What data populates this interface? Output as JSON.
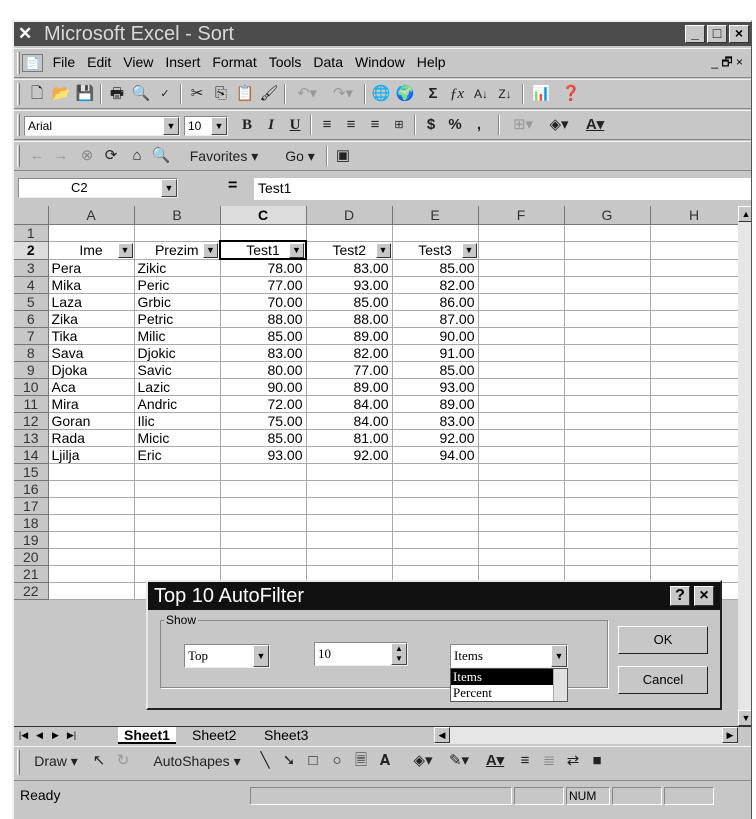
{
  "window": {
    "title": "Microsoft Excel - Sort",
    "min_label": "_",
    "max_label": "□",
    "close_label": "×"
  },
  "menu": {
    "items": [
      "File",
      "Edit",
      "View",
      "Insert",
      "Format",
      "Tools",
      "Data",
      "Window",
      "Help"
    ],
    "doc_controls": "_ 🗗 ×"
  },
  "toolbar_std": {
    "icons": [
      "new-icon",
      "open-icon",
      "save-icon",
      "print-icon",
      "print-preview-icon",
      "spelling-icon",
      "cut-icon",
      "copy-icon",
      "paste-icon",
      "format-painter-icon",
      "undo-icon",
      "redo-icon",
      "hyperlink-icon",
      "web-toolbar-icon",
      "autosum-icon",
      "paste-function-icon",
      "sort-ascending-icon",
      "sort-descending-icon",
      "chart-wizard-icon",
      "help-icon"
    ]
  },
  "toolbar_fmt": {
    "font": "Arial",
    "size": "10",
    "bold": "B",
    "italic": "I",
    "underline": "U",
    "currency": "$",
    "percent": "%",
    "comma": ","
  },
  "web_toolbar": {
    "favorites": "Favorites",
    "go": "Go"
  },
  "formula_bar": {
    "name_box": "C2",
    "equals": "=",
    "formula": "Test1"
  },
  "columns": [
    "A",
    "B",
    "C",
    "D",
    "E",
    "F",
    "G",
    "H"
  ],
  "rows": [
    {
      "n": "1",
      "cells": [
        "",
        "",
        "",
        "",
        ""
      ]
    },
    {
      "n": "2",
      "cells": [
        "Ime",
        "Prezim",
        "Test1",
        "Test2",
        "Test3"
      ]
    },
    {
      "n": "3",
      "cells": [
        "Pera",
        "Zikic",
        "78.00",
        "83.00",
        "85.00"
      ]
    },
    {
      "n": "4",
      "cells": [
        "Mika",
        "Peric",
        "77.00",
        "93.00",
        "82.00"
      ]
    },
    {
      "n": "5",
      "cells": [
        "Laza",
        "Grbic",
        "70.00",
        "85.00",
        "86.00"
      ]
    },
    {
      "n": "6",
      "cells": [
        "Zika",
        "Petric",
        "88.00",
        "88.00",
        "87.00"
      ]
    },
    {
      "n": "7",
      "cells": [
        "Tika",
        "Milic",
        "85.00",
        "89.00",
        "90.00"
      ]
    },
    {
      "n": "8",
      "cells": [
        "Sava",
        "Djokic",
        "83.00",
        "82.00",
        "91.00"
      ]
    },
    {
      "n": "9",
      "cells": [
        "Djoka",
        "Savic",
        "80.00",
        "77.00",
        "85.00"
      ]
    },
    {
      "n": "10",
      "cells": [
        "Aca",
        "Lazic",
        "90.00",
        "89.00",
        "93.00"
      ]
    },
    {
      "n": "11",
      "cells": [
        "Mira",
        "Andric",
        "72.00",
        "84.00",
        "89.00"
      ]
    },
    {
      "n": "12",
      "cells": [
        "Goran",
        "Ilic",
        "75.00",
        "84.00",
        "83.00"
      ]
    },
    {
      "n": "13",
      "cells": [
        "Rada",
        "Micic",
        "85.00",
        "81.00",
        "92.00"
      ]
    },
    {
      "n": "14",
      "cells": [
        "Ljilja",
        "Eric",
        "93.00",
        "92.00",
        "94.00"
      ]
    },
    {
      "n": "15",
      "cells": [
        "",
        "",
        "",
        "",
        ""
      ]
    },
    {
      "n": "16",
      "cells": [
        "",
        "",
        "",
        "",
        ""
      ]
    },
    {
      "n": "17",
      "cells": [
        "",
        "",
        "",
        "",
        ""
      ]
    },
    {
      "n": "18",
      "cells": [
        "",
        "",
        "",
        "",
        ""
      ]
    },
    {
      "n": "19",
      "cells": [
        "",
        "",
        "",
        "",
        ""
      ]
    },
    {
      "n": "20",
      "cells": [
        "",
        "",
        "",
        "",
        ""
      ]
    },
    {
      "n": "21",
      "cells": [
        "",
        "",
        "",
        "",
        ""
      ]
    },
    {
      "n": "22",
      "cells": [
        "",
        "",
        "",
        "",
        ""
      ]
    }
  ],
  "sheets": [
    "Sheet1",
    "Sheet2",
    "Sheet3"
  ],
  "draw_toolbar": {
    "draw": "Draw",
    "autoshapes": "AutoShapes"
  },
  "status": {
    "left": "Ready",
    "num": "NUM"
  },
  "dialog": {
    "title": "Top 10 AutoFilter",
    "help": "?",
    "close": "×",
    "group": "Show",
    "direction": "Top",
    "count": "10",
    "type": "Items",
    "options": [
      "Items",
      "Percent"
    ],
    "ok": "OK",
    "cancel": "Cancel"
  }
}
